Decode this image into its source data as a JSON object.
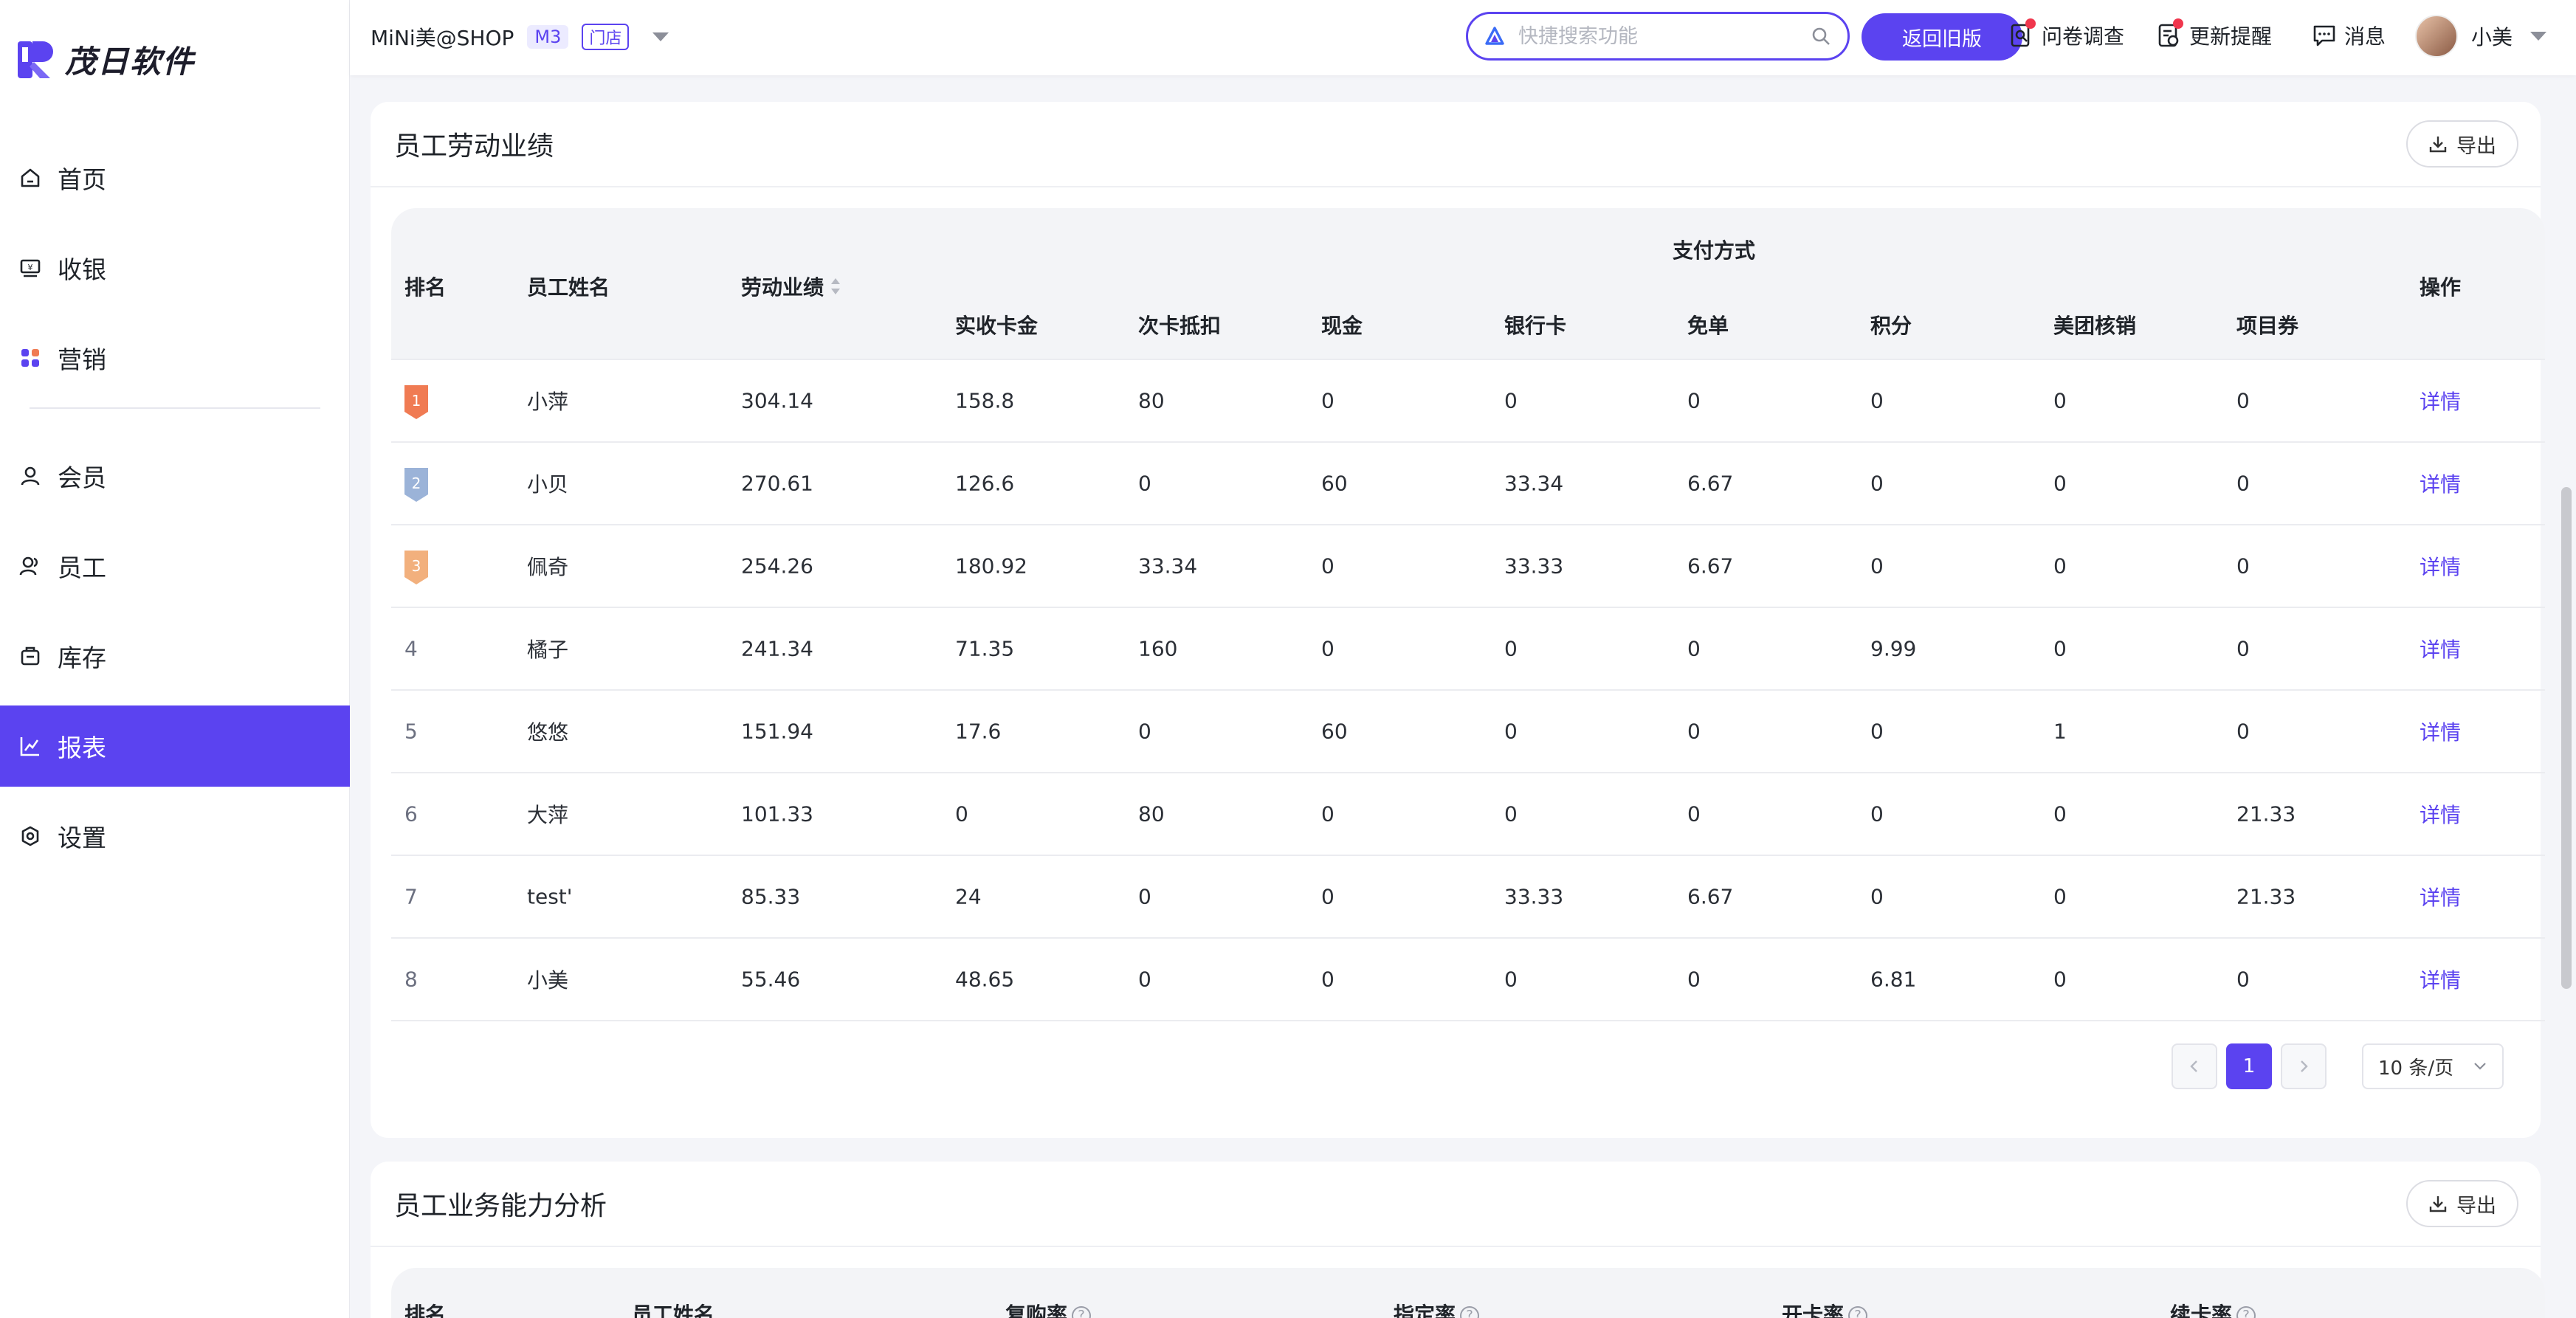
{
  "app": {
    "brand": "茂日软件",
    "colors": {
      "accent": "#5b43f0",
      "rank1": "#f07b53",
      "rank2": "#9bb3d8",
      "rank3": "#f2b07d",
      "alert": "#f0364d"
    }
  },
  "sidebar": {
    "items": [
      {
        "label": "首页",
        "icon": "home-icon"
      },
      {
        "label": "收银",
        "icon": "cashier-icon"
      },
      {
        "label": "营销",
        "icon": "marketing-icon"
      },
      {
        "label": "会员",
        "icon": "member-icon"
      },
      {
        "label": "员工",
        "icon": "staff-icon"
      },
      {
        "label": "库存",
        "icon": "inventory-icon"
      },
      {
        "label": "报表",
        "icon": "report-icon",
        "active": true
      },
      {
        "label": "设置",
        "icon": "settings-icon"
      }
    ]
  },
  "header": {
    "shop_name": "MiNi美@SHOP",
    "plan_tag": "M3",
    "store_tag": "门店",
    "search_placeholder": "快捷搜索功能",
    "back_old_label": "返回旧版",
    "survey_label": "问卷调查",
    "update_label": "更新提醒",
    "message_label": "消息",
    "user_name": "小美"
  },
  "labor": {
    "title": "员工劳动业绩",
    "export_label": "导出",
    "columns": {
      "rank": "排名",
      "name": "员工姓名",
      "labor": "劳动业绩",
      "payment_group": "支付方式",
      "card": "实收卡金",
      "times": "次卡抵扣",
      "cash": "现金",
      "bank": "银行卡",
      "free": "免单",
      "points": "积分",
      "meituan": "美团核销",
      "voucher": "项目券",
      "action": "操作"
    },
    "rows": [
      {
        "rank": "1",
        "name": "小萍",
        "labor": "304.14",
        "card": "158.8",
        "times": "80",
        "cash": "0",
        "bank": "0",
        "free": "0",
        "points": "0",
        "meituan": "0",
        "voucher": "0",
        "action": "详情"
      },
      {
        "rank": "2",
        "name": "小贝",
        "labor": "270.61",
        "card": "126.6",
        "times": "0",
        "cash": "60",
        "bank": "33.34",
        "free": "6.67",
        "points": "0",
        "meituan": "0",
        "voucher": "0",
        "action": "详情"
      },
      {
        "rank": "3",
        "name": "佩奇",
        "labor": "254.26",
        "card": "180.92",
        "times": "33.34",
        "cash": "0",
        "bank": "33.33",
        "free": "6.67",
        "points": "0",
        "meituan": "0",
        "voucher": "0",
        "action": "详情"
      },
      {
        "rank": "4",
        "name": "橘子",
        "labor": "241.34",
        "card": "71.35",
        "times": "160",
        "cash": "0",
        "bank": "0",
        "free": "0",
        "points": "9.99",
        "meituan": "0",
        "voucher": "0",
        "action": "详情"
      },
      {
        "rank": "5",
        "name": "悠悠",
        "labor": "151.94",
        "card": "17.6",
        "times": "0",
        "cash": "60",
        "bank": "0",
        "free": "0",
        "points": "0",
        "meituan": "1",
        "voucher": "0",
        "action": "详情"
      },
      {
        "rank": "6",
        "name": "大萍",
        "labor": "101.33",
        "card": "0",
        "times": "80",
        "cash": "0",
        "bank": "0",
        "free": "0",
        "points": "0",
        "meituan": "0",
        "voucher": "21.33",
        "action": "详情"
      },
      {
        "rank": "7",
        "name": "test'",
        "labor": "85.33",
        "card": "24",
        "times": "0",
        "cash": "0",
        "bank": "33.33",
        "free": "6.67",
        "points": "0",
        "meituan": "0",
        "voucher": "21.33",
        "action": "详情"
      },
      {
        "rank": "8",
        "name": "小美",
        "labor": "55.46",
        "card": "48.65",
        "times": "0",
        "cash": "0",
        "bank": "0",
        "free": "0",
        "points": "6.81",
        "meituan": "0",
        "voucher": "0",
        "action": "详情"
      }
    ],
    "pagination": {
      "current": "1",
      "page_size": "10 条/页"
    }
  },
  "ability": {
    "title": "员工业务能力分析",
    "export_label": "导出",
    "columns": {
      "rank": "排名",
      "name": "员工姓名",
      "repurchase": "复购率",
      "designated": "指定率",
      "open_card": "开卡率",
      "renew_card": "续卡率"
    }
  }
}
